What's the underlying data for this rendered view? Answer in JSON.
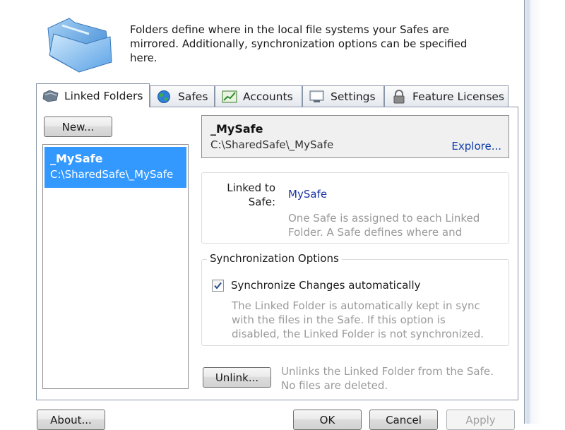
{
  "intro": {
    "text": "Folders define where in the local file systems your Safes are mirrored. Additionally, synchronization options can be specified here."
  },
  "tabs": [
    {
      "label": "Linked Folders",
      "icon": "linked-folders-icon",
      "active": true
    },
    {
      "label": "Safes",
      "icon": "globe-icon",
      "active": false
    },
    {
      "label": "Accounts",
      "icon": "accounts-chart-icon",
      "active": false
    },
    {
      "label": "Settings",
      "icon": "settings-monitor-icon",
      "active": false
    },
    {
      "label": "Feature Licenses",
      "icon": "padlock-icon",
      "active": false
    }
  ],
  "left": {
    "new_button": "New...",
    "folders": [
      {
        "name": "_MySafe",
        "path": "C:\\SharedSafe\\_MySafe",
        "selected": true
      }
    ]
  },
  "detail": {
    "name": "_MySafe",
    "path": "C:\\SharedSafe\\_MySafe",
    "explore_link": "Explore...",
    "linked_to_label_line1": "Linked to",
    "linked_to_label_line2": "Safe:",
    "linked_to_value": "MySafe",
    "linked_desc_line1": "One Safe is assigned to each Linked",
    "linked_desc_line2": "Folder. A Safe defines where and",
    "sync_legend": "Synchronization Options",
    "sync_checkbox_label": "Synchronize Changes automatically",
    "sync_checked": true,
    "sync_desc_line1": "The Linked Folder is automatically kept in sync",
    "sync_desc_line2": "with the files in the Safe. If this option is",
    "sync_desc_line3": "disabled, the Linked Folder is not synchronized.",
    "unlink_button": "Unlink...",
    "unlink_desc_line1": "Unlinks the Linked Folder from the Safe.",
    "unlink_desc_line2": "No files are deleted."
  },
  "footer": {
    "about": "About...",
    "ok": "OK",
    "cancel": "Cancel",
    "apply": "Apply"
  },
  "colors": {
    "selection": "#3399ff",
    "link": "#0a3aa8",
    "disabled_text": "#9a9a9a"
  }
}
